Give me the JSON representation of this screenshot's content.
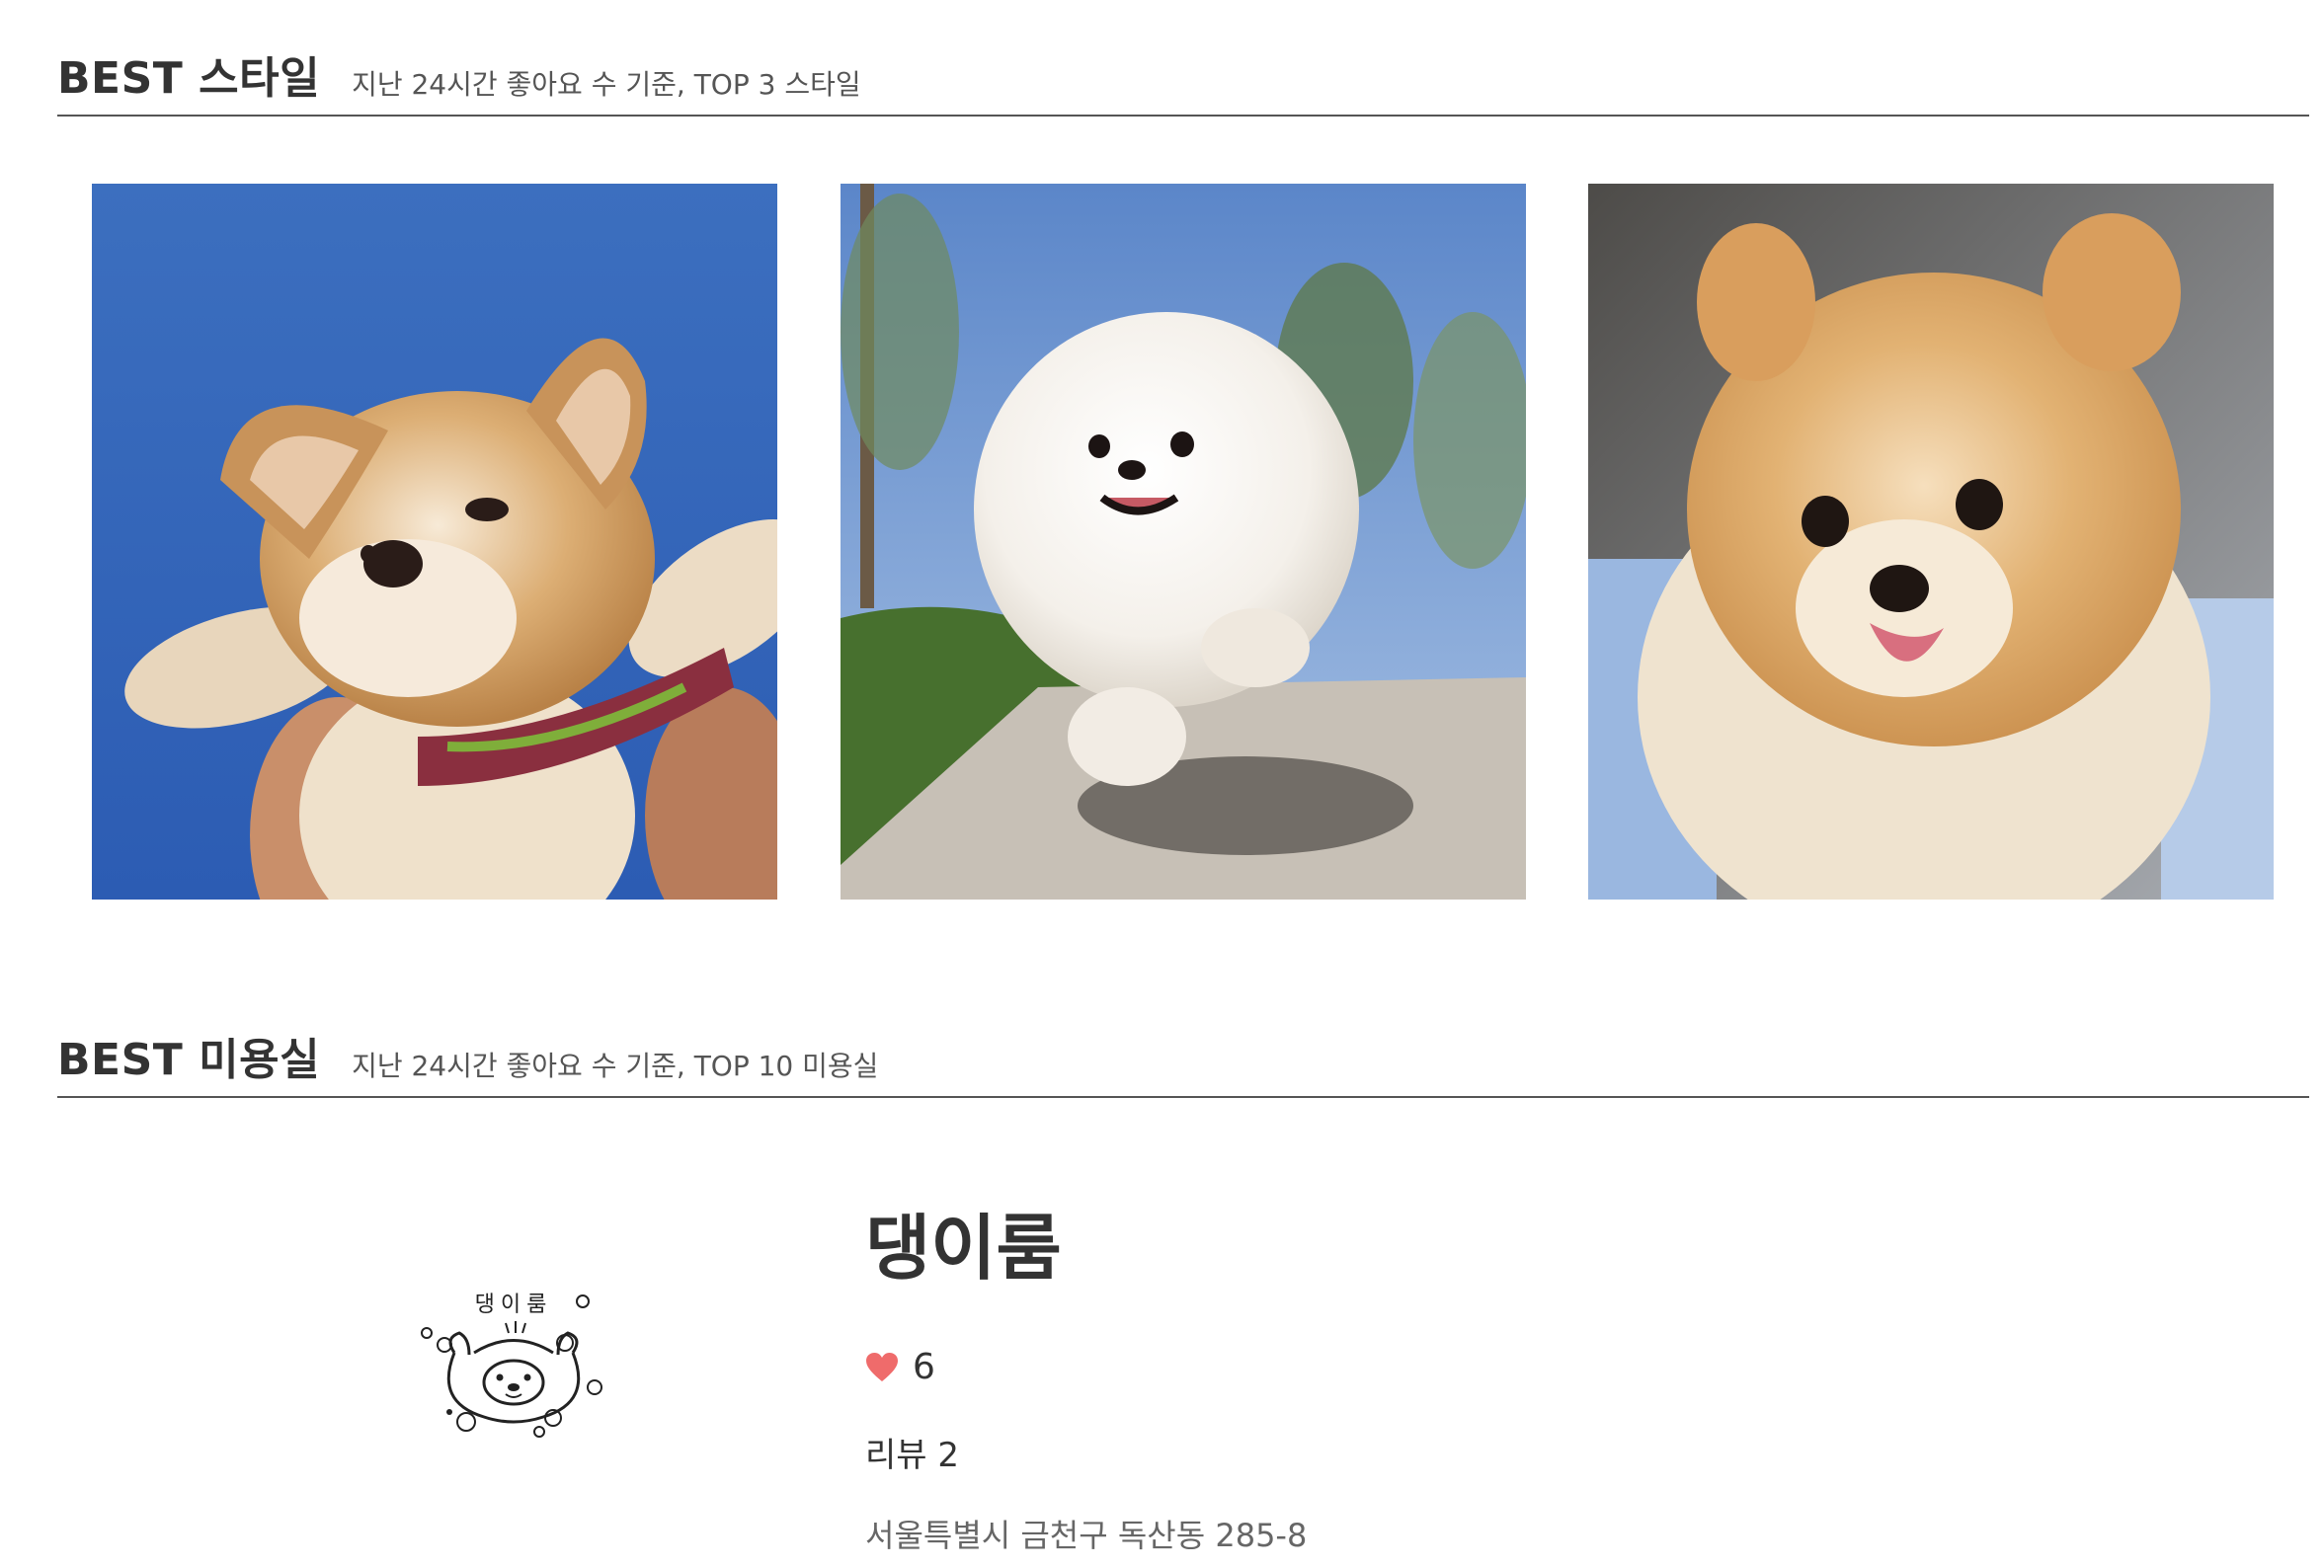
{
  "best_styles": {
    "title": "BEST 스타일",
    "subtitle": "지난 24시간 좋아요 수 기준, TOP 3 스타일",
    "items": [
      {
        "image": "corgi-puppy-photo"
      },
      {
        "image": "white-pomeranian-photo"
      },
      {
        "image": "orange-pomeranian-photo"
      }
    ]
  },
  "best_salons": {
    "title": "BEST 미용실",
    "subtitle": "지난 24시간 좋아요 수 기준, TOP 10 미용실",
    "items": [
      {
        "logo": "dog-face-logo",
        "logo_text": "댕이룸",
        "name": "댕이룸",
        "like_icon": "heart-icon",
        "likes": "6",
        "reviews": "리뷰 2",
        "address": "서울특별시 금천구 독산동 285-8"
      }
    ]
  },
  "colors": {
    "heart": "#ef6b6b",
    "text": "#333333",
    "divider": "#555555"
  }
}
